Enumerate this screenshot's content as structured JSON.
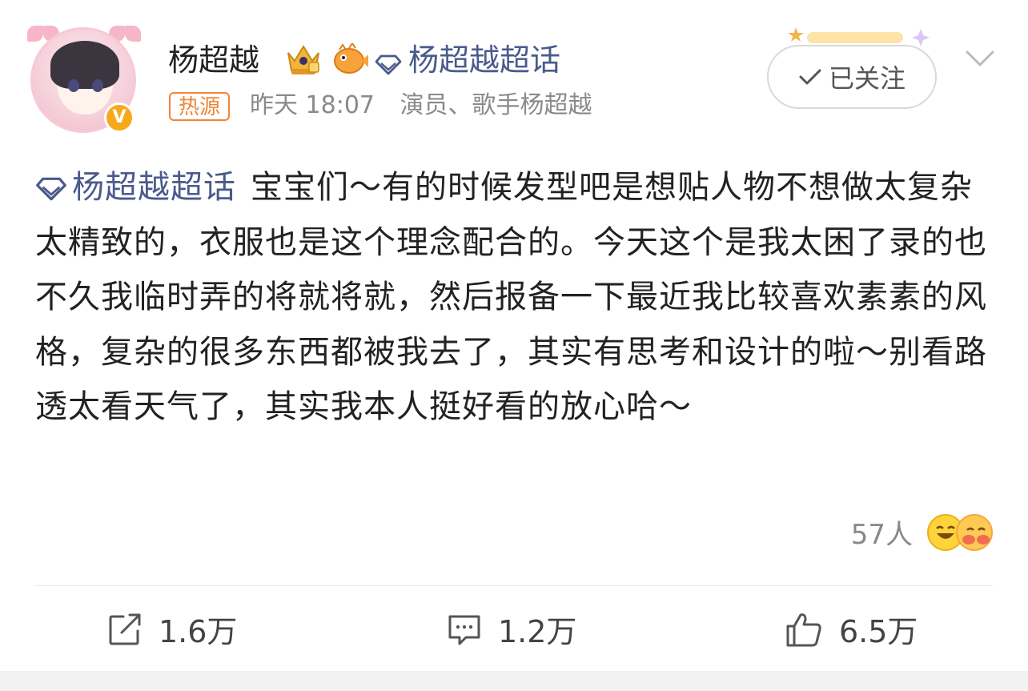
{
  "header": {
    "username": "杨超越",
    "topic_link": "杨超越超话",
    "hot_tag": "热源",
    "time": "昨天 18:07",
    "verified_desc": "演员、歌手杨超越",
    "follow_label": "已关注"
  },
  "post": {
    "topic": "杨超越超话",
    "text": "宝宝们～有的时候发型吧是想贴人物不想做太复杂太精致的，衣服也是这个理念配合的。今天这个是我太困了录的也不久我临时弄的将就将就，然后报备一下最近我比较喜欢素素的风格，复杂的很多东西都被我去了，其实有思考和设计的啦～别看路透太看天气了，其实我本人挺好看的放心哈～"
  },
  "reactions": {
    "count": "57人"
  },
  "actions": {
    "repost": "1.6万",
    "comment": "1.2万",
    "like": "6.5万"
  },
  "colors": {
    "topic": "#4a5a8c",
    "hot_tag": "#f0853a",
    "verified": "#f7a91b"
  }
}
